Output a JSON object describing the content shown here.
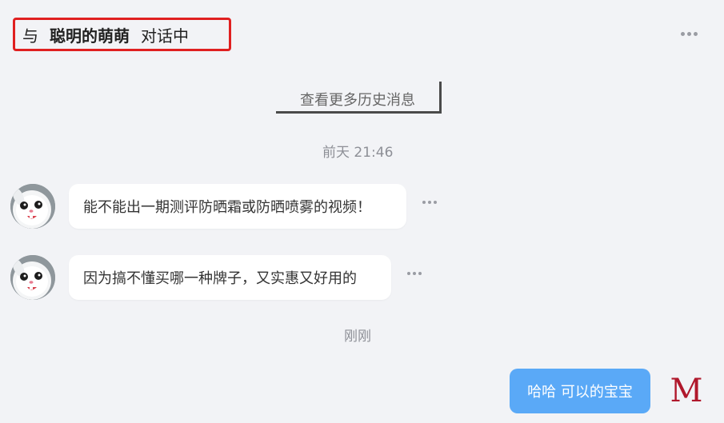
{
  "header": {
    "prefix": "与",
    "contact_name": "聪明的萌萌",
    "suffix": "对话中",
    "more_icon": "more-dots-icon"
  },
  "history_button": {
    "label": "查看更多历史消息"
  },
  "messages": [
    {
      "type": "timestamp",
      "text": "前天 21:46"
    },
    {
      "type": "incoming",
      "text": "能不能出一期测评防晒霜或防晒喷雾的视频！",
      "avatar_icon": "snowball-rabbit-avatar"
    },
    {
      "type": "incoming",
      "text": "因为搞不懂买哪一种牌子，又实惠又好用的",
      "avatar_icon": "snowball-rabbit-avatar"
    },
    {
      "type": "timestamp",
      "text": "刚刚"
    },
    {
      "type": "outgoing",
      "text": "哈哈 可以的宝宝",
      "avatar_text": "M"
    }
  ],
  "colors": {
    "background": "#f2f3f6",
    "outgoing_bubble": "#5aa9f7",
    "highlight_box": "#e02020",
    "my_avatar_text": "#b0182c"
  }
}
